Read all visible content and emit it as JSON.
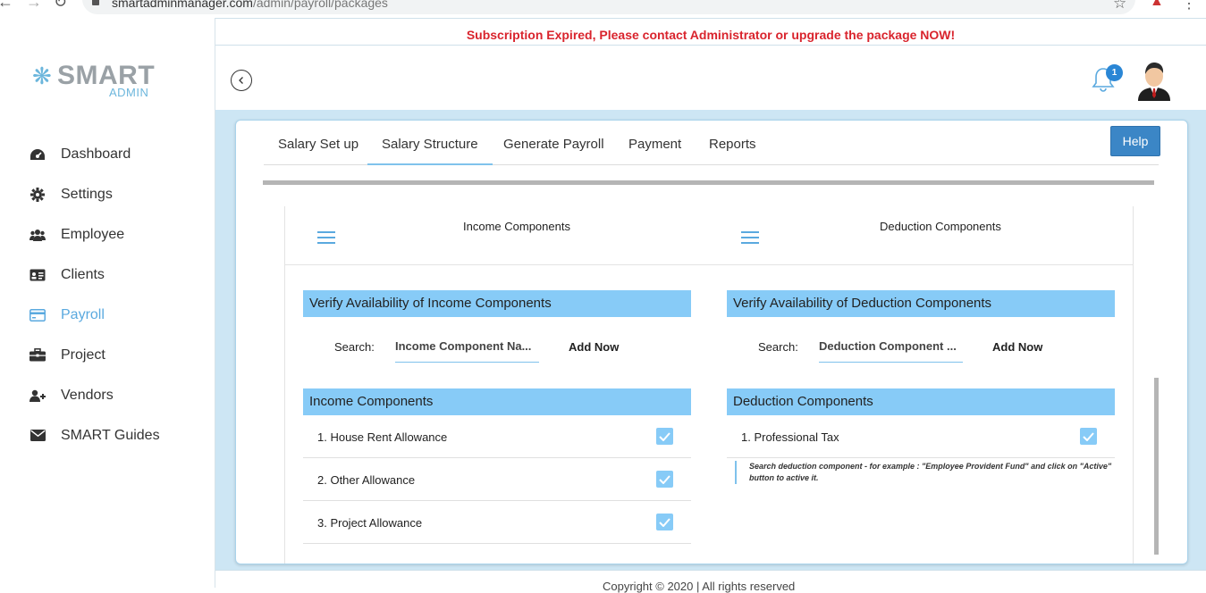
{
  "browser": {
    "url_host": "smartadminmanager.com",
    "url_path": "/admin/payroll/packages"
  },
  "logo": {
    "word": "SMART",
    "sub": "ADMIN"
  },
  "sidebar": {
    "items": [
      {
        "label": "Dashboard",
        "icon": "dashboard-icon"
      },
      {
        "label": "Settings",
        "icon": "gear-icon"
      },
      {
        "label": "Employee",
        "icon": "users-icon"
      },
      {
        "label": "Clients",
        "icon": "id-card-icon"
      },
      {
        "label": "Payroll",
        "icon": "credit-card-icon",
        "active": true
      },
      {
        "label": "Project",
        "icon": "briefcase-icon"
      },
      {
        "label": "Vendors",
        "icon": "user-plus-icon"
      },
      {
        "label": "SMART Guides",
        "icon": "envelope-icon"
      }
    ]
  },
  "header": {
    "alert": "Subscription Expired, Please contact Administrator or upgrade the package NOW!",
    "notification_count": "1"
  },
  "tabs": [
    {
      "label": "Salary Set up"
    },
    {
      "label": "Salary Structure",
      "active": true
    },
    {
      "label": "Generate Payroll"
    },
    {
      "label": "Payment"
    },
    {
      "label": "Reports"
    }
  ],
  "help_label": "Help",
  "income": {
    "column_title": "Income Components",
    "verify_title": "Verify Availability of Income Components",
    "search_label": "Search:",
    "search_value": "Income Component Na...",
    "add_now": "Add Now",
    "list_title": "Income Components",
    "items": [
      {
        "label": "1. House Rent Allowance",
        "checked": true
      },
      {
        "label": "2. Other Allowance",
        "checked": true
      },
      {
        "label": "3. Project Allowance",
        "checked": true
      }
    ]
  },
  "deduction": {
    "column_title": "Deduction Components",
    "verify_title": "Verify Availability of Deduction Components",
    "search_label": "Search:",
    "search_value": "Deduction Component ...",
    "add_now": "Add Now",
    "list_title": "Deduction Components",
    "items": [
      {
        "label": "1. Professional Tax",
        "checked": true
      }
    ],
    "hint": "Search deduction component - for example : \"Employee Provident Fund\" and click on \"Active\" button to active it."
  },
  "footer": {
    "text": "Copyright © 2020 | All rights reserved"
  },
  "colors": {
    "accent": "#87cbf7",
    "alert": "#d9242d",
    "help_button": "#3b86c6",
    "active_menu": "#5aa9df",
    "badge": "#2a86d5"
  }
}
